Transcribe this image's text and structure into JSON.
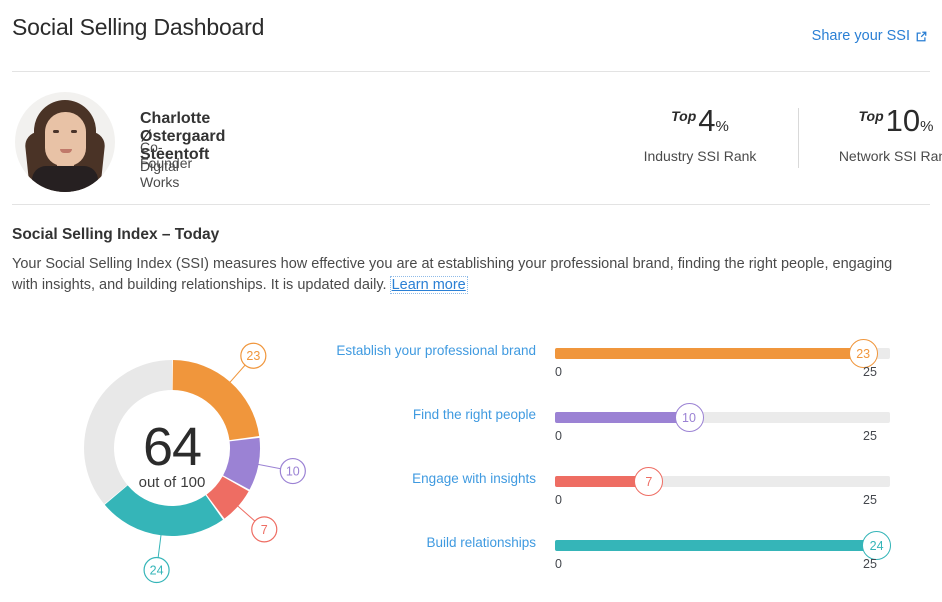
{
  "header": {
    "title": "Social Selling Dashboard",
    "share_label": "Share your SSI",
    "share_icon": "external-link-icon"
  },
  "profile": {
    "name": "Charlotte Østergaard Steentoft",
    "title": "Co-Founder",
    "company": "Digital Works",
    "avatar_alt": "profile-photo"
  },
  "ranks": [
    {
      "prefix": "Top",
      "value": "4",
      "unit": "%",
      "label": "Industry SSI Rank"
    },
    {
      "prefix": "Top",
      "value": "10",
      "unit": "%",
      "label": "Network SSI Rank"
    }
  ],
  "ssi": {
    "heading": "Social Selling Index – Today",
    "description_part1": "Your Social Selling Index (SSI) measures how effective you are at establishing your professional brand, finding the right people, engaging with insights, and building relationships. It is updated daily. ",
    "learn_more_label": "Learn more"
  },
  "colors": {
    "brand_blue": "#2a7fd4",
    "label_blue": "#3f9ae0",
    "orange": "#f0963c",
    "purple": "#9b82d4",
    "red": "#ee6d63",
    "teal": "#35b5b8",
    "track_grey": "#ebebeb",
    "donut_grey": "#e8e8e8"
  },
  "chart_data": [
    {
      "type": "pie",
      "title": "Social Selling Index",
      "center_value": "64",
      "center_sub": "out of 100",
      "total": 100,
      "score": 64,
      "categories": [
        "Establish your professional brand",
        "Find the right people",
        "Engage with insights",
        "Build relationships"
      ],
      "values": [
        23,
        10,
        7,
        24
      ],
      "colors": [
        "#f0963c",
        "#9b82d4",
        "#ee6d63",
        "#35b5b8"
      ],
      "remainder_value": 36,
      "remainder_color": "#e8e8e8",
      "labels": [
        "23",
        "10",
        "7",
        "24"
      ],
      "legend": "none"
    },
    {
      "type": "bar",
      "orientation": "horizontal",
      "categories": [
        "Establish your professional brand",
        "Find the right people",
        "Engage with insights",
        "Build relationships"
      ],
      "values": [
        23,
        10,
        7,
        24
      ],
      "colors": [
        "#f0963c",
        "#9b82d4",
        "#ee6d63",
        "#35b5b8"
      ],
      "xlim": [
        0,
        25
      ],
      "tick_min": "0",
      "tick_max": "25",
      "xlabel": "",
      "ylabel": "",
      "grid": false,
      "legend": "none"
    }
  ]
}
